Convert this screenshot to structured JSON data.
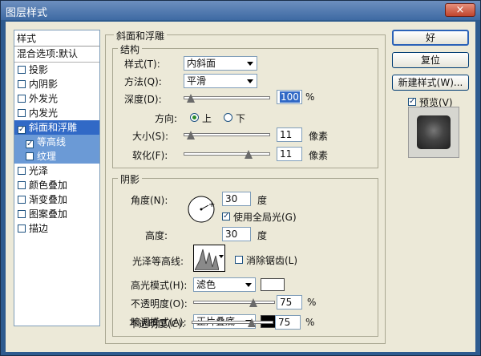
{
  "window": {
    "title": "图层样式",
    "close": "×"
  },
  "styles_list": {
    "header": "样式",
    "blend": "混合选项:默认",
    "items": [
      {
        "label": "投影",
        "checked": false
      },
      {
        "label": "内阴影",
        "checked": false
      },
      {
        "label": "外发光",
        "checked": false
      },
      {
        "label": "内发光",
        "checked": false
      },
      {
        "label": "斜面和浮雕",
        "checked": true,
        "selected": true
      },
      {
        "label": "等高线",
        "checked": true,
        "sub": true
      },
      {
        "label": "纹理",
        "checked": false,
        "sub": true
      },
      {
        "label": "光泽",
        "checked": false
      },
      {
        "label": "颜色叠加",
        "checked": false
      },
      {
        "label": "渐变叠加",
        "checked": false
      },
      {
        "label": "图案叠加",
        "checked": false
      },
      {
        "label": "描边",
        "checked": false
      }
    ]
  },
  "bevel": {
    "legend": "斜面和浮雕",
    "structure": {
      "legend": "结构",
      "style_label": "样式(T):",
      "style_value": "内斜面",
      "technique_label": "方法(Q):",
      "technique_value": "平滑",
      "depth_label": "深度(D):",
      "depth_value": "100",
      "depth_unit": "%",
      "direction_label": "方向:",
      "dir_up": "上",
      "dir_down": "下",
      "size_label": "大小(S):",
      "size_value": "11",
      "size_unit": "像素",
      "soften_label": "软化(F):",
      "soften_value": "11",
      "soften_unit": "像素"
    },
    "shading": {
      "legend": "阴影",
      "angle_label": "角度(N):",
      "angle_value": "30",
      "angle_unit": "度",
      "global_light_label": "使用全局光(G)",
      "altitude_label": "高度:",
      "altitude_value": "30",
      "altitude_unit": "度",
      "gloss_label": "光泽等高线:",
      "antialias_label": "消除锯齿(L)",
      "highlight_label": "高光模式(H):",
      "highlight_mode": "滤色",
      "highlight_color": "#ffffff",
      "hl_opacity_label": "不透明度(O):",
      "hl_opacity_value": "75",
      "hl_opacity_unit": "%",
      "shadow_label": "暗调模式(A):",
      "shadow_mode": "正片叠底",
      "shadow_color": "#000000",
      "sh_opacity_label": "不透明度(C):",
      "sh_opacity_value": "75",
      "sh_opacity_unit": "%"
    }
  },
  "buttons": {
    "ok": "好",
    "reset": "复位",
    "new_style": "新建样式(W)...",
    "preview_label": "预览(V)"
  }
}
